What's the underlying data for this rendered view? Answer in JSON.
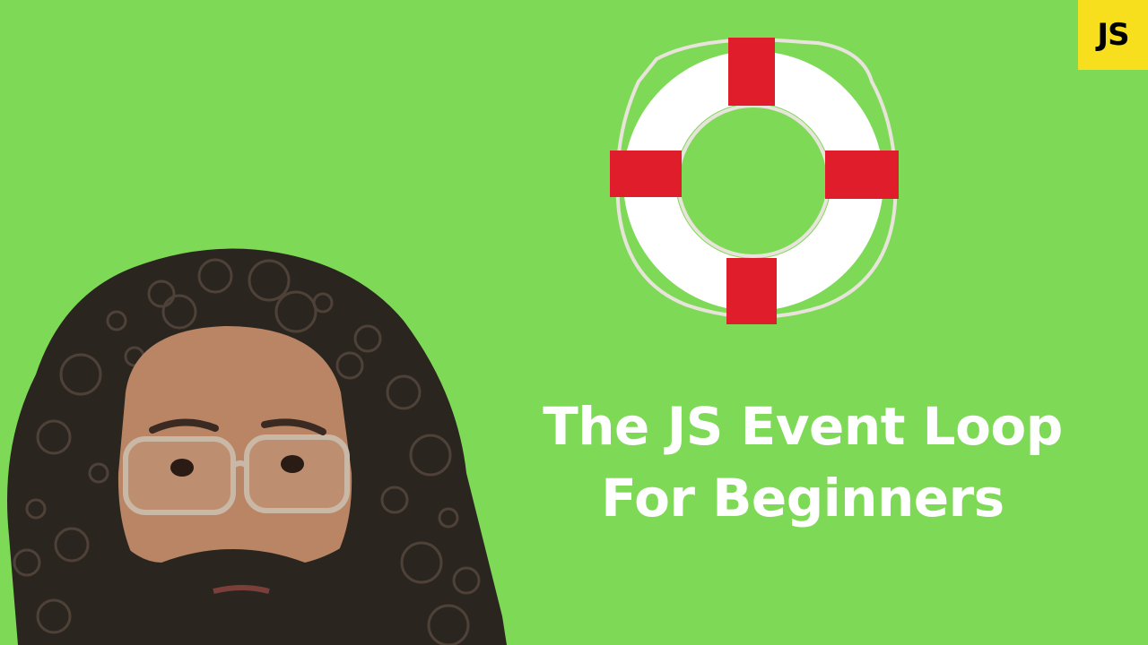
{
  "thumbnail": {
    "background_color": "#7ed957",
    "badge": {
      "label": "JS",
      "background_color": "#f7df1e",
      "text_color": "#000000"
    },
    "title": {
      "line1": "The JS Event Loop",
      "line2": "For Beginners",
      "color": "#ffffff"
    },
    "lifebuoy": {
      "ring_color": "#ffffff",
      "stripe_color": "#e01e2b",
      "rope_color": "#e8e4dc"
    },
    "person": {
      "hair_color": "#2b2520",
      "skin_color": "#b98565"
    }
  }
}
